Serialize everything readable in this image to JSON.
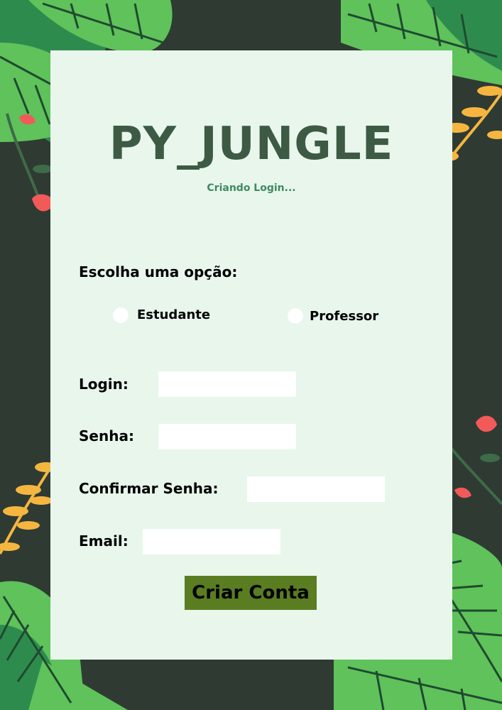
{
  "header": {
    "title": "PY_JUNGLE",
    "subtitle": "Criando Login..."
  },
  "form": {
    "choose_label": "Escolha uma opção:",
    "options": [
      {
        "label": "Estudante",
        "selected": false
      },
      {
        "label": "Professor",
        "selected": false
      }
    ],
    "login_label": "Login:",
    "login_value": "",
    "password_label": "Senha:",
    "password_value": "",
    "confirm_label": "Confirmar Senha:",
    "confirm_value": "",
    "email_label": "Email:",
    "email_value": "",
    "submit_label": "Criar Conta"
  },
  "colors": {
    "background": "#2f3a33",
    "panel": "#e8f6ec",
    "title": "#3d5a44",
    "subtitle": "#3f8a5f",
    "button": "#5a7d22",
    "leaf_light": "#5fc25a",
    "leaf_dark": "#2e8b4e",
    "flower": "#f25a5a",
    "branch": "#f5b640"
  }
}
